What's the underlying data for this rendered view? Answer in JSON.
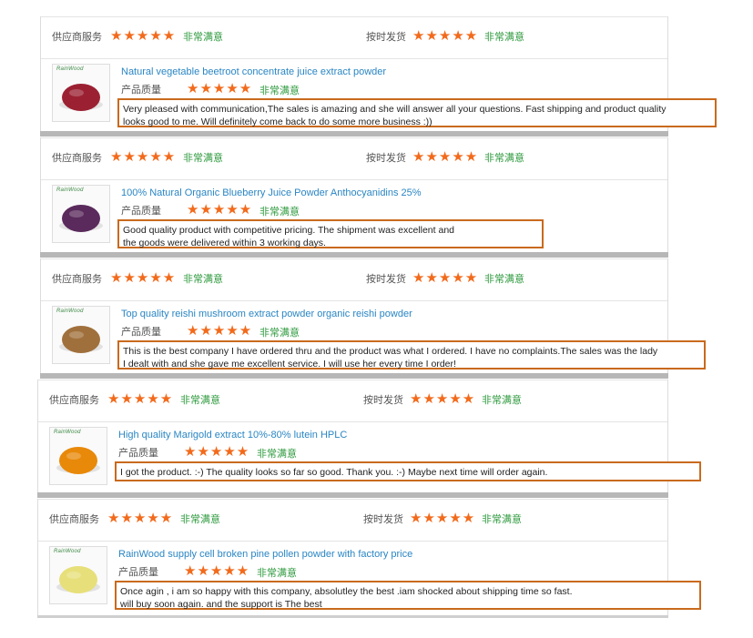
{
  "labels": {
    "supplier_service": "供应商服务",
    "shipping_speed": "按时发货",
    "product_quality": "产品质量",
    "very_satisfied": "非常满意",
    "stars": "★★★★★"
  },
  "reviews": [
    {
      "product_title": "Natural vegetable beetroot concentrate juice extract powder",
      "brand": "RainWood",
      "thumb_color": "#9b2132",
      "comment_lines": [
        "Very pleased with communication,The sales is amazing and she will answer all your questions. Fast shipping and product quality",
        "looks good to me. Will definitely come back to do some more business :))"
      ]
    },
    {
      "product_title": "100% Natural Organic Blueberry Juice Powder Anthocyanidins 25%",
      "brand": "RainWood",
      "thumb_color": "#5a2a5c",
      "comment_lines": [
        "Good quality product with competitive pricing. The shipment was excellent and",
        "the goods were delivered within 3 working days."
      ]
    },
    {
      "product_title": "Top quality reishi mushroom extract powder organic reishi powder",
      "brand": "RainWood",
      "thumb_color": "#a0703c",
      "comment_lines": [
        "This is the best company I have ordered thru and the product was what I ordered. I have no complaints.The sales was the lady",
        "I dealt with and she gave me excellent service. I will use her every time I order!"
      ]
    },
    {
      "product_title": "High quality Marigold extract 10%-80% lutein HPLC",
      "brand": "RainWood",
      "thumb_color": "#e8890a",
      "comment_lines": [
        "I got the product. :-) The quality looks so far so good. Thank you. :-) Maybe next time will order again."
      ]
    },
    {
      "product_title": "RainWood supply cell broken pine pollen powder with factory price",
      "brand": "RainWood",
      "thumb_color": "#e7df7a",
      "comment_lines": [
        "Once agin , i am so happy with this company, absolutley the best .iam shocked about shipping time so fast.",
        "will buy soon again. and the support is The best"
      ]
    }
  ]
}
